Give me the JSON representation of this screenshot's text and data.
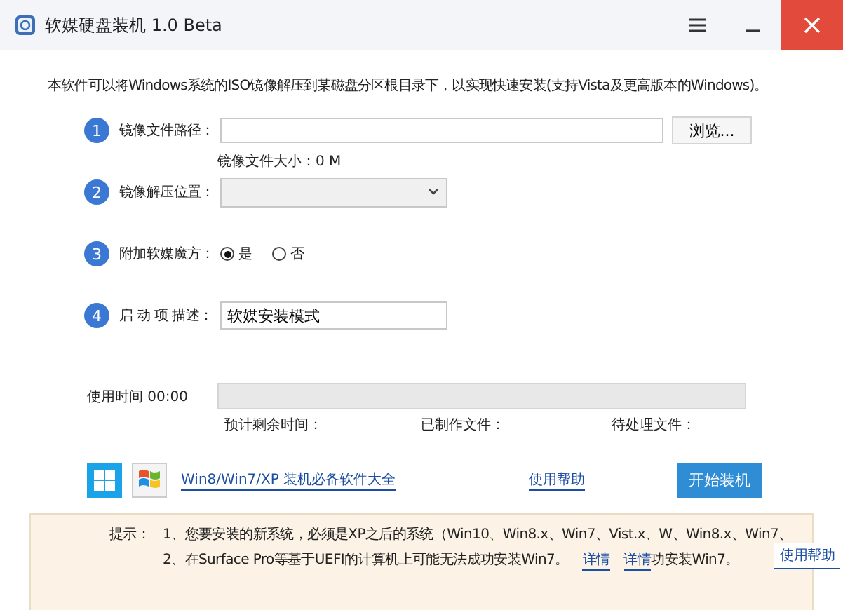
{
  "window": {
    "title": "软媒硬盘装机 1.0 Beta"
  },
  "description": "本软件可以将Windows系统的ISO镜像解压到某磁盘分区根目录下，以实现快速安装(支持Vista及更高版本的Windows)。",
  "steps": [
    {
      "number": "1",
      "label": "镜像文件路径：",
      "kind": "file",
      "button": "浏览...",
      "size_label": "镜像文件大小：",
      "size_value": "0 M"
    },
    {
      "number": "2",
      "label": "镜像解压位置：",
      "kind": "dropdown"
    },
    {
      "number": "3",
      "label": "附加软媒魔方：",
      "kind": "radio",
      "options": [
        {
          "label": "是",
          "selected": true
        },
        {
          "label": "否",
          "selected": false
        }
      ]
    },
    {
      "number": "4",
      "label": "启 动 项 描述：",
      "kind": "text",
      "value": "软媒安装模式"
    }
  ],
  "progress": {
    "elapsed": "使用时间 00:00",
    "level": 0,
    "stats": [
      "预计剩余时间：",
      "已制作文件：",
      "待处理文件："
    ]
  },
  "footer": {
    "link": "Win8/Win7/XP 装机必备软件大全",
    "help": "使用帮助",
    "start": "开始装机"
  },
  "tips": {
    "label": "提示：",
    "line1": "1、您要安装的新系统，必须是XP之后的系统（Win10、Win8.x、Win7、Vist.x、W、Win8.x、Win7、",
    "line2": "2、在Surface Pro等基于UEFI的计算机上可能无法成功安装Win7。",
    "links": [
      "详情",
      "详情"
    ],
    "tail": "功安装Win7。",
    "help": "使用帮助"
  }
}
